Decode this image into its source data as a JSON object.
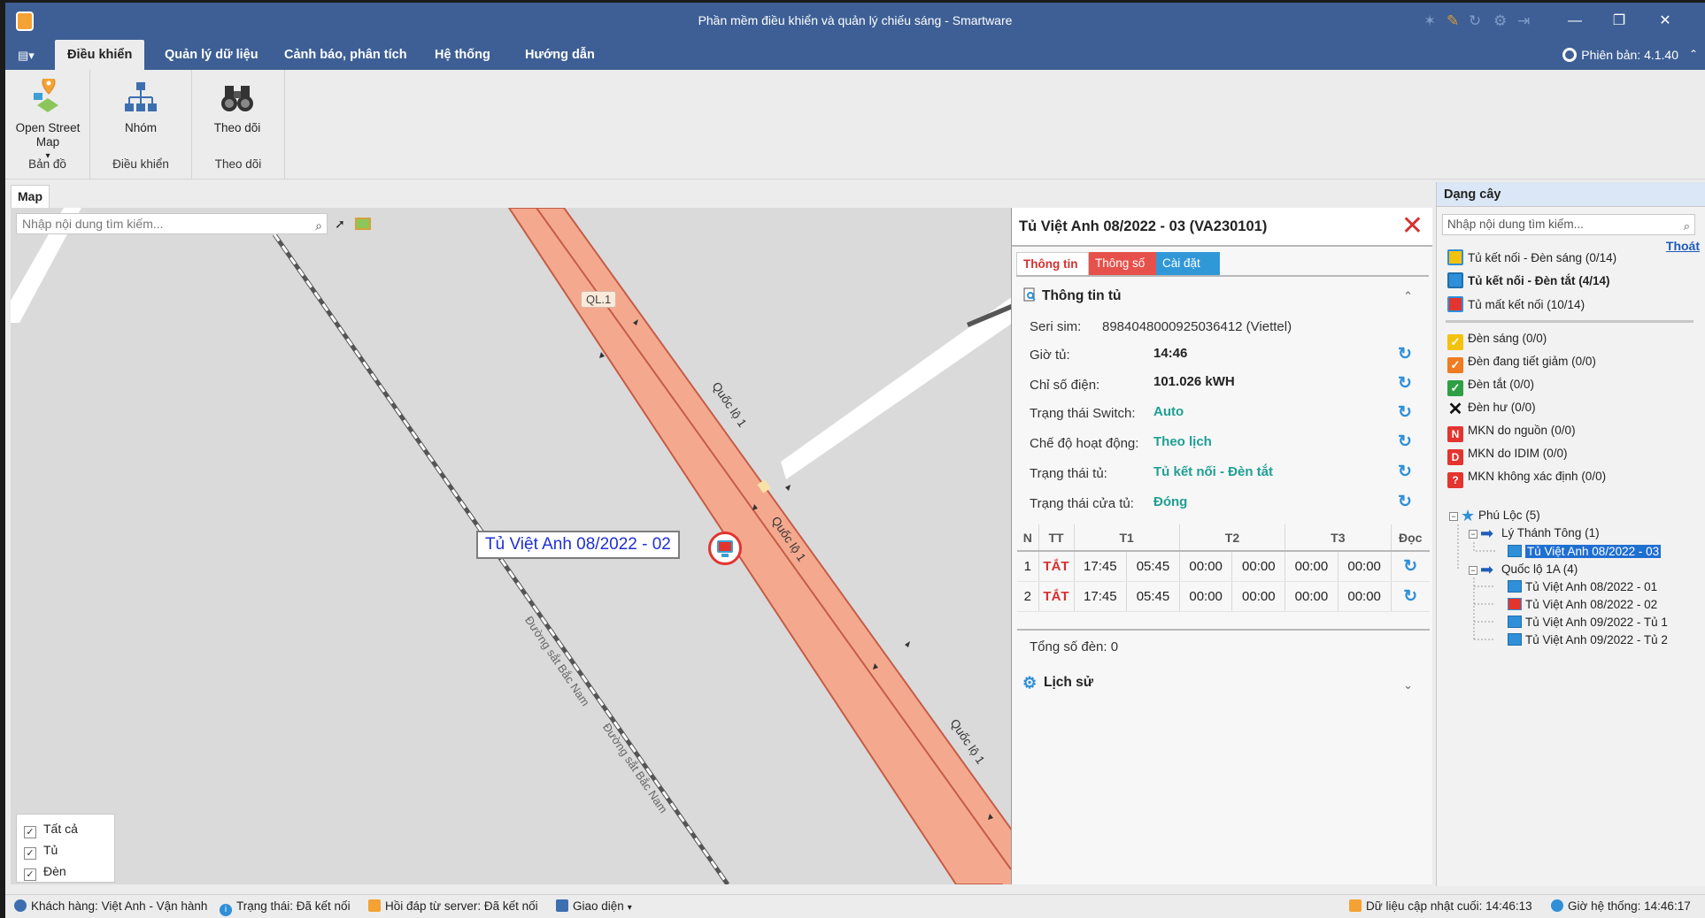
{
  "window": {
    "title": "Phần mềm điều khiển và quản lý chiếu sáng - Smartware"
  },
  "menu": {
    "tabs": [
      {
        "label": "Điều khiển"
      },
      {
        "label": "Quản lý dữ liệu"
      },
      {
        "label": "Cảnh báo, phân tích"
      },
      {
        "label": "Hệ thống"
      },
      {
        "label": "Hướng dẫn"
      }
    ],
    "version": "Phiên bản: 4.1.40"
  },
  "ribbon": {
    "groups": [
      {
        "button": "Open Street Map",
        "label": "Bản đồ"
      },
      {
        "button": "Nhóm",
        "label": "Điều khiển"
      },
      {
        "button": "Theo dõi",
        "label": "Theo dõi"
      }
    ]
  },
  "map": {
    "tab": "Map",
    "search_placeholder": "Nhập nội dung tìm kiếm...",
    "road_labels": {
      "ql1_badge": "QL.1",
      "road_1": "Quốc lộ 1",
      "road_2": "Quốc lộ 1",
      "road_3": "Quốc lộ 1",
      "rail_1": "Đường sắt Bắc Nam",
      "rail_2": "Đường sắt Bắc Nam"
    },
    "marker_label": "Tủ Việt Anh 08/2022 - 02",
    "layers": [
      {
        "label": "Tất cả",
        "checked": true
      },
      {
        "label": "Tủ",
        "checked": true
      },
      {
        "label": "Đèn",
        "checked": true
      }
    ]
  },
  "panel": {
    "title": "Tủ Việt Anh 08/2022 - 03 (VA230101)",
    "tabs": [
      "Thông tin",
      "Thông số",
      "Cài đặt"
    ],
    "info_section": "Thông tin tủ",
    "sim_label": "Seri sim:",
    "sim_value": "8984048000925036412 (Viettel)",
    "rows": [
      {
        "label": "Giờ tủ:",
        "value": "14:46"
      },
      {
        "label": "Chỉ số điện:",
        "value": "101.026 kWH"
      },
      {
        "label": "Trạng thái Switch:",
        "value": "Auto"
      },
      {
        "label": "Chế độ hoạt động:",
        "value": "Theo lịch"
      },
      {
        "label": "Trạng thái tủ:",
        "value": "Tủ kết nối - Đèn tắt"
      },
      {
        "label": "Trạng thái cửa tủ:",
        "value": "Đóng"
      }
    ],
    "schedule": {
      "headers": [
        "N",
        "TT",
        "T1",
        "T2",
        "T3",
        "Đọc"
      ],
      "rows": [
        [
          "1",
          "TẮT",
          "17:45",
          "05:45",
          "00:00",
          "00:00",
          "00:00",
          "00:00"
        ],
        [
          "2",
          "TẮT",
          "17:45",
          "05:45",
          "00:00",
          "00:00",
          "00:00",
          "00:00"
        ]
      ]
    },
    "total": "Tổng số đèn: 0",
    "history": "Lịch sử"
  },
  "sidebar": {
    "title": "Dạng cây",
    "search_placeholder": "Nhập nội dung tìm kiếm...",
    "exit": "Thoát",
    "cabinet_legend": [
      {
        "label": "Tủ kết nối - Đèn sáng (0/14)",
        "bold": false,
        "color": "#f4c20d"
      },
      {
        "label": "Tủ kết nối - Đèn tắt (4/14)",
        "bold": true,
        "color": "#2f8fd8"
      },
      {
        "label": "Tủ mất kết nối (10/14)",
        "bold": false,
        "color": "#e3342f"
      }
    ],
    "lamp_legend": [
      {
        "label": "Đèn sáng (0/0)",
        "color": "#f4c20d",
        "icon": "check"
      },
      {
        "label": "Đèn đang tiết giảm (0/0)",
        "color": "#f07b20",
        "icon": "check"
      },
      {
        "label": "Đèn tắt (0/0)",
        "color": "#2ea043",
        "icon": "check"
      },
      {
        "label": "Đèn hư (0/0)",
        "color": "#111111",
        "icon": "x"
      },
      {
        "label": "MKN do nguồn (0/0)",
        "color": "#e3342f",
        "icon": "N"
      },
      {
        "label": "MKN do IDIM (0/0)",
        "color": "#e3342f",
        "icon": "D"
      },
      {
        "label": "MKN không xác định (0/0)",
        "color": "#e3342f",
        "icon": "?"
      }
    ],
    "tree": {
      "root": "Phú Lộc (5)",
      "groups": [
        {
          "label": "Lý Thánh Tông (1)",
          "items": [
            {
              "label": "Tủ Việt Anh 08/2022 - 03",
              "status": "blue",
              "selected": true
            }
          ]
        },
        {
          "label": "Quốc lộ 1A (4)",
          "items": [
            {
              "label": "Tủ Việt Anh 08/2022 - 01",
              "status": "blue",
              "selected": false
            },
            {
              "label": "Tủ Việt Anh 08/2022 - 02",
              "status": "red",
              "selected": false
            },
            {
              "label": "Tủ Việt Anh 09/2022 - Tủ 1",
              "status": "blue",
              "selected": false
            },
            {
              "label": "Tủ Việt Anh 09/2022 - Tủ 2",
              "status": "blue",
              "selected": false
            }
          ]
        }
      ]
    }
  },
  "status": {
    "customer": "Khách hàng: Việt Anh - Vận hành",
    "state": "Trạng thái: Đã kết nối",
    "server": "Hồi đáp từ server: Đã kết nối",
    "theme": "Giao diện",
    "last_update": "Dữ liệu cập nhật cuối: 14:46:13",
    "system_time": "Giờ hệ thống: 14:46:17"
  },
  "colors": {
    "titlebar": "#3d5f95",
    "road": "#f4a98f",
    "road_edge": "#c55c46",
    "accent_red": "#e3342f",
    "accent_blue": "#2f8fd8",
    "status_green": "#1e9f94"
  }
}
